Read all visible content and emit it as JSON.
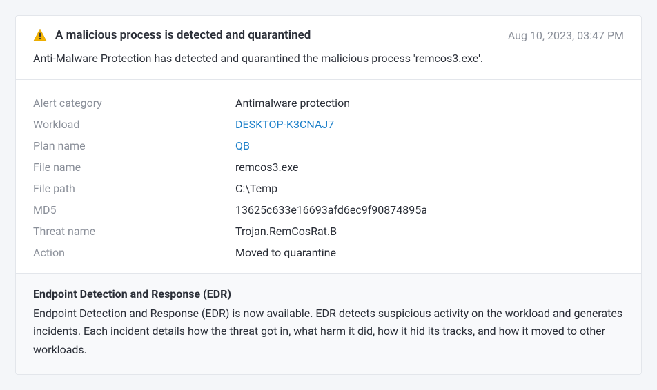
{
  "alert": {
    "title": "A malicious process is detected and quarantined",
    "timestamp": "Aug 10, 2023, 03:47 PM",
    "description": "Anti-Malware Protection has detected and quarantined the malicious process 'remcos3.exe'."
  },
  "details": [
    {
      "label": "Alert category",
      "value": "Antimalware protection",
      "link": false
    },
    {
      "label": "Workload",
      "value": "DESKTOP-K3CNAJ7",
      "link": true
    },
    {
      "label": "Plan name",
      "value": "QB",
      "link": true
    },
    {
      "label": "File name",
      "value": "remcos3.exe",
      "link": false
    },
    {
      "label": "File path",
      "value": "C:\\Temp",
      "link": false
    },
    {
      "label": "MD5",
      "value": "13625c633e16693afd6ec9f90874895a",
      "link": false
    },
    {
      "label": "Threat name",
      "value": "Trojan.RemCosRat.B",
      "link": false
    },
    {
      "label": "Action",
      "value": "Moved to quarantine",
      "link": false
    }
  ],
  "edr": {
    "title": "Endpoint Detection and Response (EDR)",
    "text": "Endpoint Detection and Response (EDR) is now available. EDR detects suspicious activity on the workload and generates incidents. Each incident details how the threat got in, what harm it did, how it hid its tracks, and how it moved to other workloads."
  }
}
